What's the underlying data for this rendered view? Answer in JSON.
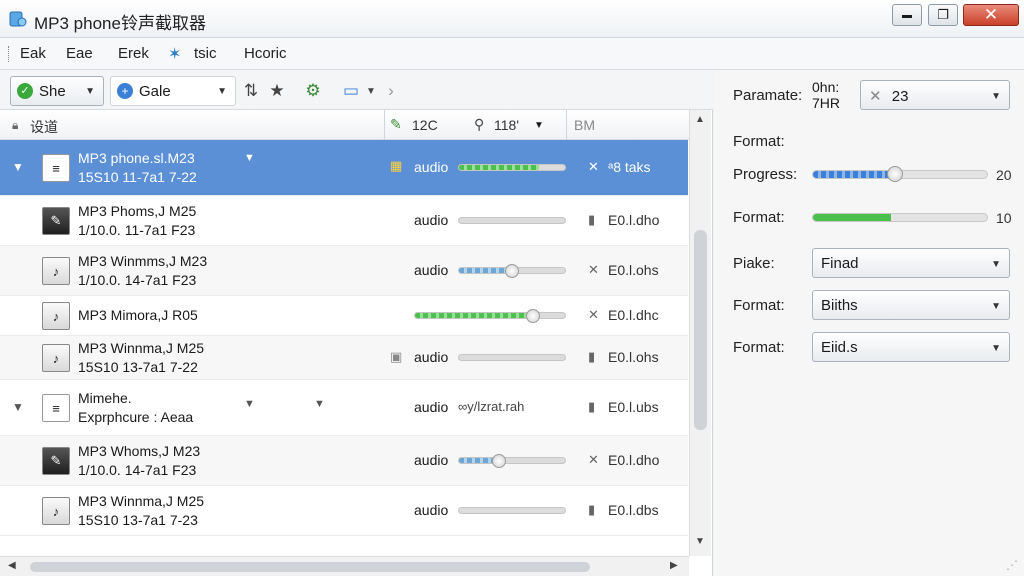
{
  "window": {
    "title": "MP3 phone铃声截取器",
    "min": "▬",
    "max": "❐",
    "close": "✕"
  },
  "menu": [
    "Eak",
    "Eae",
    "Erek",
    "tsic",
    "Hcoric"
  ],
  "toolbar": {
    "combo1": "She",
    "combo2": "Gale",
    "icons": [
      "sort-icon",
      "star-icon",
      "network-icon",
      "monitor-icon",
      "forward-icon"
    ]
  },
  "columns": {
    "name": "设道",
    "duration": "12C",
    "size": "118'",
    "status": "BM"
  },
  "rows": [
    {
      "name": "MP3 phone.sl.M23",
      "sub": "15S10 11-7a1 7-22",
      "type": "audio",
      "progress": 0.75,
      "status": "ᵃ8 taks",
      "icon": "x"
    },
    {
      "name": "MP3 Phoms,J M25",
      "sub": "1/10.0. 11-7a1 F23",
      "type": "audio",
      "progress": 0,
      "status": "E0.l.dho",
      "icon": "file"
    },
    {
      "name": "MP3 Winmms,J M23",
      "sub": "1/10.0. 14-7a1 F23",
      "type": "audio",
      "progress": 0.5,
      "status": "E0.l.ohs",
      "icon": "x"
    },
    {
      "name": "MP3 Mimora,J R05",
      "sub": "",
      "type": "",
      "progress": 0.78,
      "status": "E0.l.dhc",
      "icon": "x"
    },
    {
      "name": "MP3 Winnma,J M25",
      "sub": "15S10 13-7a1 7-22",
      "type": "audio",
      "progress": 0,
      "status": "E0.l.ohs",
      "icon": "file"
    },
    {
      "name": "Mimehe.",
      "sub": "Exprphcure : Aeaa",
      "type": "audio",
      "progress": 0,
      "status": "E0.l.ubs",
      "icon": "file",
      "inline": "∞y/lzrat.rah"
    },
    {
      "name": "MP3 Whoms,J M23",
      "sub": "1/10.0. 14-7a1 F23",
      "type": "audio",
      "progress": 0.38,
      "status": "E0.l.dho",
      "icon": "x"
    },
    {
      "name": "MP3 Winnma,J M25",
      "sub": "15S10 13-7a1 7-23",
      "type": "audio",
      "progress": 0,
      "status": "E0.l.dbs",
      "icon": "file"
    }
  ],
  "params": {
    "title": "Paramate:",
    "info1": "0hn:",
    "info2": "7HR",
    "combo_top": "23",
    "format1": "Format:",
    "progress_label": "Progress:",
    "progress_value": "20",
    "progress_level": 0.47,
    "format2": "Format:",
    "format2_value": "10",
    "format2_level": 0.45,
    "piake": "Piake:",
    "piake_value": "Finad",
    "format3": "Format:",
    "format3_value": "Biiths",
    "format4": "Format:",
    "format4_value": "Eiid.s"
  },
  "colors": {
    "selected": "#5b8fd6",
    "accent_green": "#4cc04c",
    "accent_blue": "#3c7fd6"
  }
}
